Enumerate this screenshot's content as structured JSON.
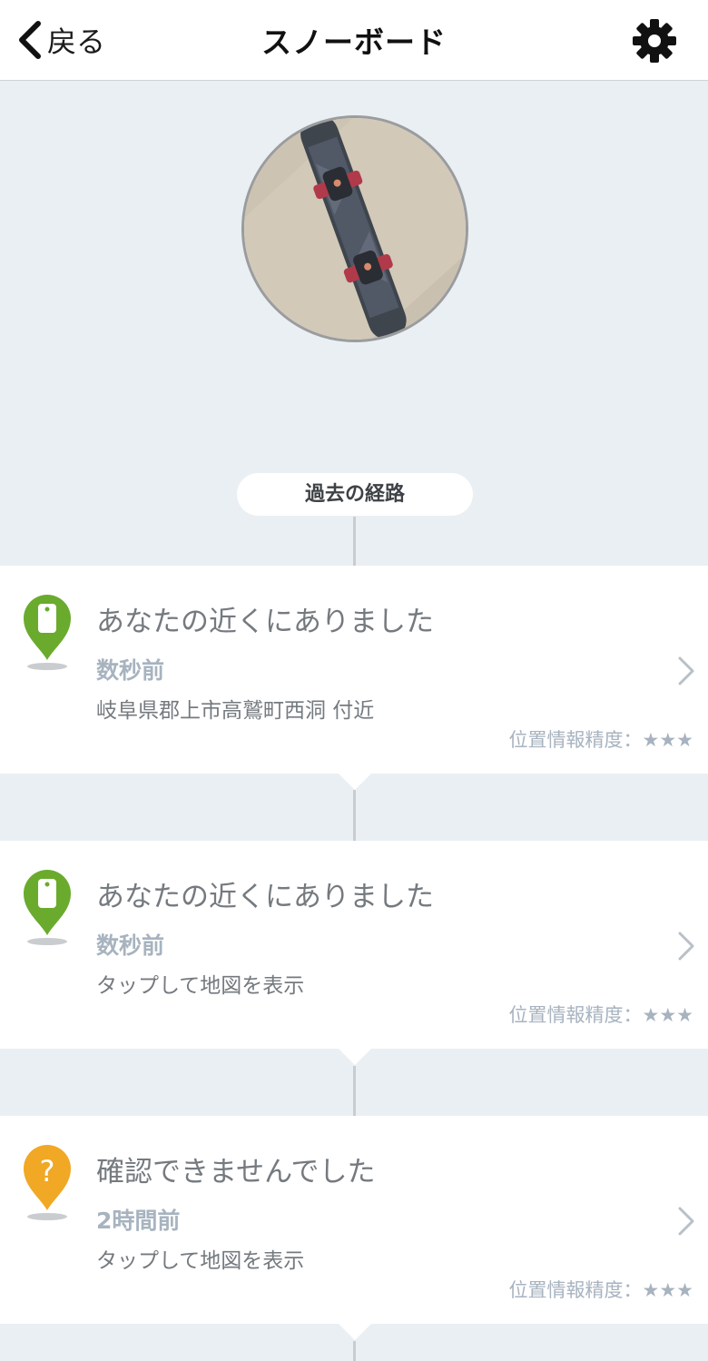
{
  "header": {
    "back_label": "戻る",
    "title": "スノーボード",
    "settings_icon": "gear-icon"
  },
  "hero": {
    "photo_alt": "snowboard photo",
    "history_label": "過去の経路"
  },
  "records": [
    {
      "status": "found",
      "icon": "green-tag-pin-icon",
      "title": "あなたの近くにありました",
      "time": "数秒前",
      "location": "岐阜県郡上市高鷲町西洞 付近",
      "accuracy": "位置情報精度：★★★"
    },
    {
      "status": "found",
      "icon": "green-tag-pin-icon",
      "title": "あなたの近くにありました",
      "time": "数秒前",
      "location": "タップして地図を表示",
      "accuracy": "位置情報精度：★★★"
    },
    {
      "status": "unknown",
      "icon": "orange-question-pin-icon",
      "title": "確認できませんでした",
      "time": "2時間前",
      "location": "タップして地図を表示",
      "accuracy": "位置情報精度：★★★"
    }
  ],
  "colors": {
    "found_pin": "#6aab2e",
    "unknown_pin": "#f0a825",
    "muted_text": "#a7b3bf",
    "body_text": "#757a7f",
    "background": "#eaeff3"
  }
}
